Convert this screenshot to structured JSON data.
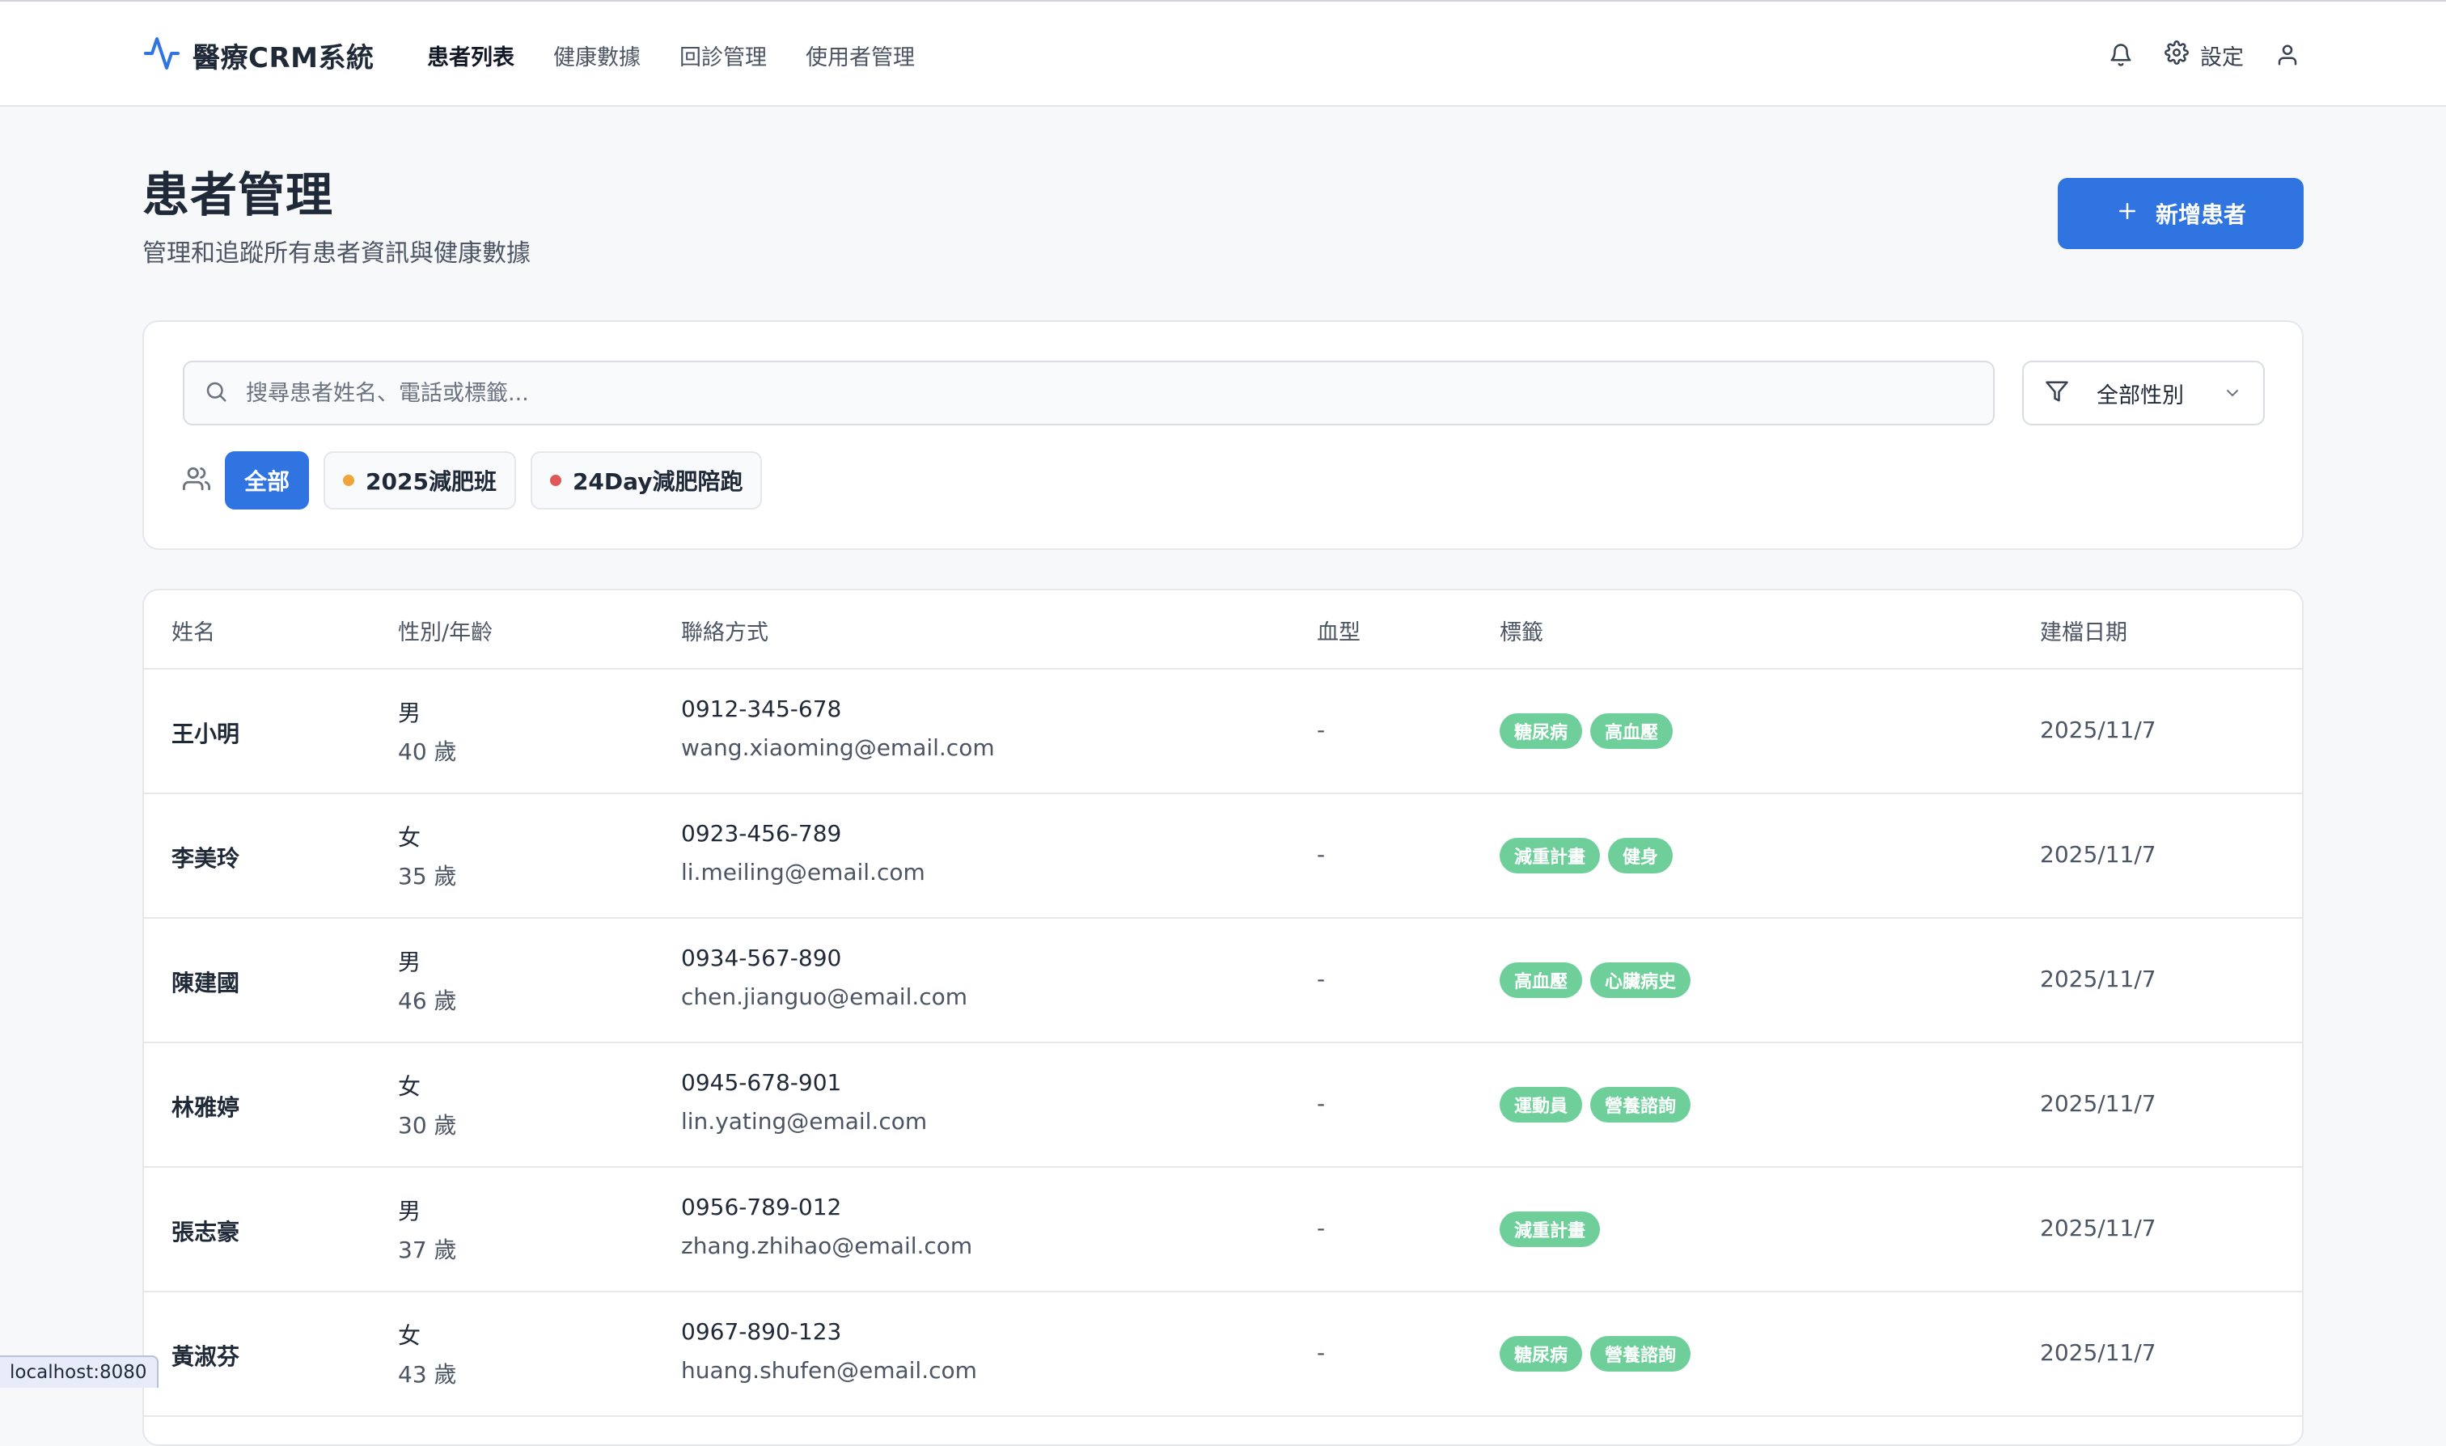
{
  "app": {
    "brand": "醫療CRM系統",
    "nav": [
      "患者列表",
      "健康數據",
      "回診管理",
      "使用者管理"
    ],
    "active_nav": "患者列表",
    "settings_label": "設定",
    "icons": {
      "logo": "pulse-icon",
      "notification": "bell-icon",
      "settings": "gear-icon",
      "user": "user-icon"
    }
  },
  "header": {
    "title": "患者管理",
    "subtitle": "管理和追蹤所有患者資訊與健康數據",
    "add_button": "新增患者"
  },
  "filters": {
    "search_placeholder": "搜尋患者姓名、電話或標籤...",
    "search_value": "",
    "gender_select": "全部性別",
    "chips": [
      {
        "label": "全部",
        "active": true,
        "dot_color": null
      },
      {
        "label": "2025減肥班",
        "active": false,
        "dot_color": "#f0a53b"
      },
      {
        "label": "24Day減肥陪跑",
        "active": false,
        "dot_color": "#e05757"
      }
    ]
  },
  "table": {
    "columns": [
      "姓名",
      "性別/年齡",
      "聯絡方式",
      "血型",
      "標籤",
      "建檔日期"
    ],
    "rows": [
      {
        "name": "王小明",
        "gender": "男",
        "age": "40 歲",
        "phone": "0912-345-678",
        "email": "wang.xiaoming@email.com",
        "blood": "-",
        "tags": [
          "糖尿病",
          "高血壓"
        ],
        "date": "2025/11/7"
      },
      {
        "name": "李美玲",
        "gender": "女",
        "age": "35 歲",
        "phone": "0923-456-789",
        "email": "li.meiling@email.com",
        "blood": "-",
        "tags": [
          "減重計畫",
          "健身"
        ],
        "date": "2025/11/7"
      },
      {
        "name": "陳建國",
        "gender": "男",
        "age": "46 歲",
        "phone": "0934-567-890",
        "email": "chen.jianguo@email.com",
        "blood": "-",
        "tags": [
          "高血壓",
          "心臟病史"
        ],
        "date": "2025/11/7"
      },
      {
        "name": "林雅婷",
        "gender": "女",
        "age": "30 歲",
        "phone": "0945-678-901",
        "email": "lin.yating@email.com",
        "blood": "-",
        "tags": [
          "運動員",
          "營養諮詢"
        ],
        "date": "2025/11/7"
      },
      {
        "name": "張志豪",
        "gender": "男",
        "age": "37 歲",
        "phone": "0956-789-012",
        "email": "zhang.zhihao@email.com",
        "blood": "-",
        "tags": [
          "減重計畫"
        ],
        "date": "2025/11/7"
      },
      {
        "name": "黃淑芬",
        "gender": "女",
        "age": "43 歲",
        "phone": "0967-890-123",
        "email": "huang.shufen@email.com",
        "blood": "-",
        "tags": [
          "糖尿病",
          "營養諮詢"
        ],
        "date": "2025/11/7"
      }
    ]
  },
  "status_bar": {
    "url": "localhost:8080"
  },
  "colors": {
    "primary": "#2f74e0",
    "tag_green": "#6fcf9b"
  }
}
